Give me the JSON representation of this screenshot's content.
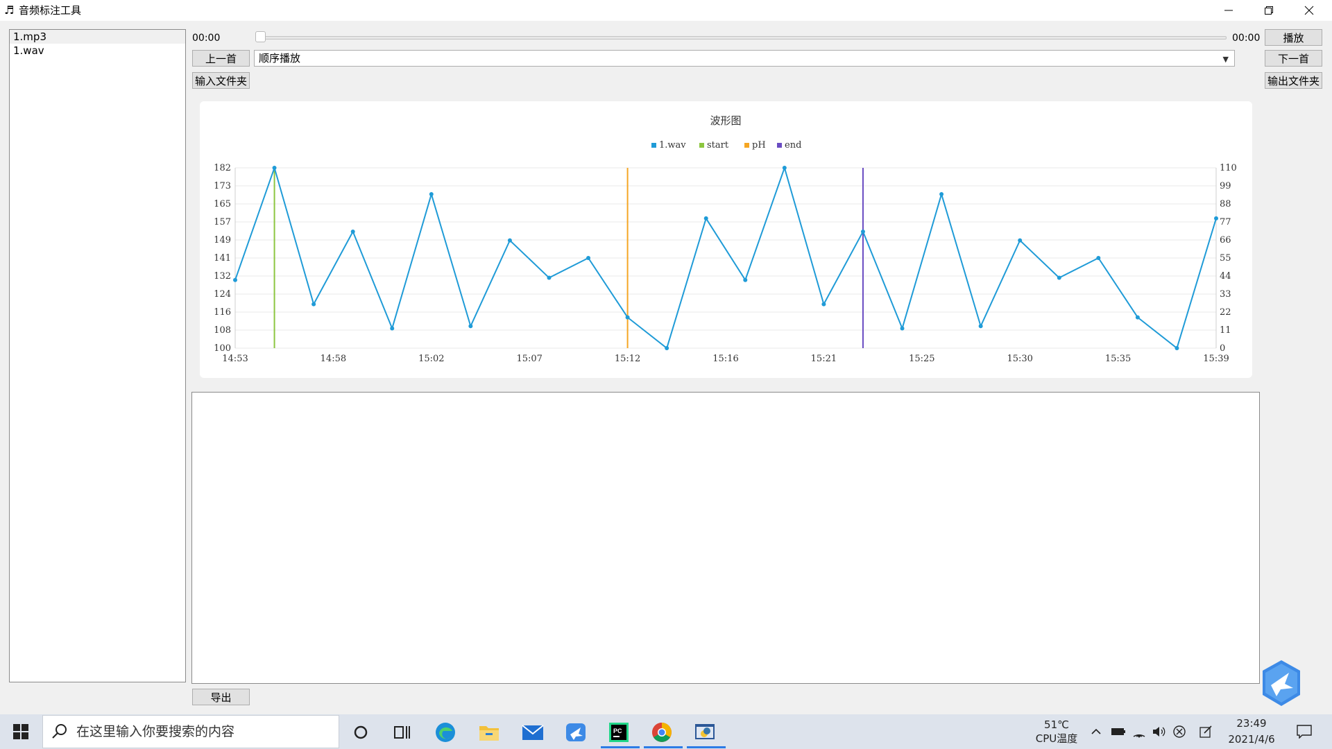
{
  "window": {
    "title": "音频标注工具",
    "app_icon": "♬"
  },
  "file_list": [
    "1.mp3",
    "1.wav"
  ],
  "player": {
    "time_current": "00:00",
    "time_total": "00:00",
    "play_label": "播放",
    "prev_label": "上一首",
    "next_label": "下一首",
    "mode_value": "顺序播放",
    "input_folder_label": "输入文件夹",
    "output_folder_label": "输出文件夹"
  },
  "export_label": "导出",
  "chart_data": {
    "type": "line",
    "title": "波形图",
    "legend": [
      {
        "name": "1.wav",
        "color": "#1f9bd7"
      },
      {
        "name": "start",
        "color": "#8cc63f"
      },
      {
        "name": "pH",
        "color": "#f5a623"
      },
      {
        "name": "end",
        "color": "#6a4cc2"
      }
    ],
    "x_ticks": [
      "14:53",
      "14:58",
      "15:02",
      "15:07",
      "15:12",
      "15:16",
      "15:21",
      "15:25",
      "15:30",
      "15:35",
      "15:39"
    ],
    "y_left_ticks": [
      "100",
      "108",
      "116",
      "124",
      "132",
      "141",
      "149",
      "157",
      "165",
      "173",
      "182"
    ],
    "y_right_ticks": [
      "0",
      "11",
      "22",
      "33",
      "44",
      "55",
      "66",
      "77",
      "88",
      "99",
      "110"
    ],
    "ylim": [
      100,
      182
    ],
    "series": [
      {
        "name": "1.wav",
        "color": "#1f9bd7",
        "values": [
          131,
          182,
          120,
          153,
          109,
          170,
          110,
          149,
          132,
          141,
          114,
          100,
          159,
          131,
          182,
          120,
          153,
          109,
          170,
          110,
          149,
          132,
          141,
          114,
          100,
          159
        ]
      }
    ],
    "markers": [
      {
        "name": "start",
        "index": 1,
        "color": "#8cc63f"
      },
      {
        "name": "pH",
        "index": 10,
        "color": "#f5a623"
      },
      {
        "name": "end",
        "index": 16,
        "color": "#6a4cc2"
      }
    ]
  },
  "taskbar": {
    "search_placeholder": "在这里输入你要搜索的内容",
    "temperature": "51℃",
    "temperature_label": "CPU温度",
    "time": "23:49",
    "date": "2021/4/6"
  }
}
